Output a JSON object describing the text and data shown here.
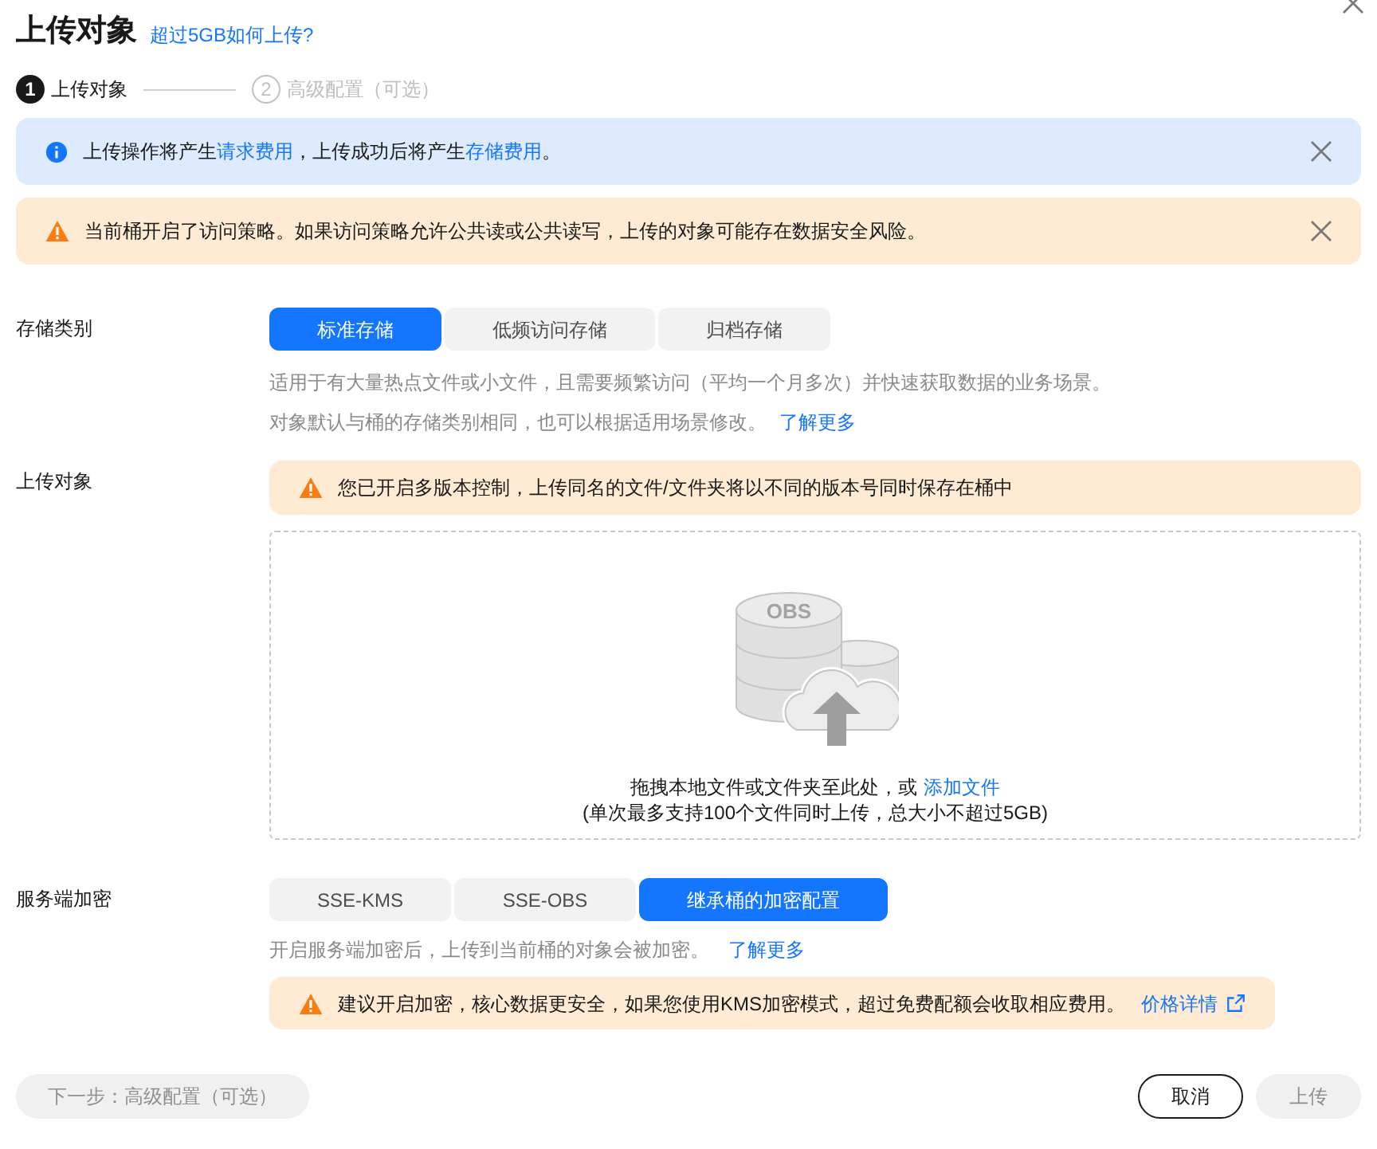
{
  "dialog": {
    "title": "上传对象",
    "help_link": "超过5GB如何上传?"
  },
  "steps": [
    {
      "number": "1",
      "label": "上传对象",
      "selected": true
    },
    {
      "number": "2",
      "label": "高级配置（可选）",
      "selected": false
    }
  ],
  "alerts": [
    {
      "kind": "info",
      "segments": [
        {
          "kind": "text",
          "text": "上传操作将产生"
        },
        {
          "kind": "link",
          "text": "请求费用"
        },
        {
          "kind": "text",
          "text": "，上传成功后将产生"
        },
        {
          "kind": "link",
          "text": "存储费用"
        },
        {
          "kind": "text",
          "text": "。"
        }
      ]
    },
    {
      "kind": "warning",
      "segments": [
        {
          "kind": "text",
          "text": "当前桶开启了访问策略。如果访问策略允许公共读或公共读写，上传的对象可能存在数据安全风险。"
        }
      ]
    }
  ],
  "storage_class": {
    "label": "存储类别",
    "options": [
      {
        "label": "标准存储",
        "selected": true
      },
      {
        "label": "低频访问存储",
        "selected": false
      },
      {
        "label": "归档存储",
        "selected": false
      }
    ],
    "description": "适用于有大量热点文件或小文件，且需要频繁访问（平均一个月多次）并快速获取数据的业务场景。",
    "note": "对象默认与桶的存储类别相同，也可以根据适用场景修改。",
    "note_link": "了解更多"
  },
  "upload": {
    "label": "上传对象",
    "warning": "您已开启多版本控制，上传同名的文件/文件夹将以不同的版本号同时保存在桶中",
    "illustration_text": "OBS",
    "drop_text": "拖拽本地文件或文件夹至此处，或",
    "add_link": "添加文件",
    "limit_text": "(单次最多支持100个文件同时上传，总大小不超过5GB)"
  },
  "encryption": {
    "label": "服务端加密",
    "options": [
      {
        "label": "SSE-KMS",
        "selected": false
      },
      {
        "label": "SSE-OBS",
        "selected": false
      },
      {
        "label": "继承桶的加密配置",
        "selected": true
      }
    ],
    "description": "开启服务端加密后，上传到当前桶的对象会被加密。",
    "description_link": "了解更多",
    "warning": "建议开启加密，核心数据更安全，如果您使用KMS加密模式，超过免费配额会收取相应费用。",
    "warning_link": "价格详情"
  },
  "footer": {
    "next_button": {
      "label": "下一步：高级配置（可选）",
      "disabled": true
    },
    "cancel_button": {
      "label": "取消",
      "disabled": false
    },
    "upload_button": {
      "label": "上传",
      "disabled": true
    }
  }
}
